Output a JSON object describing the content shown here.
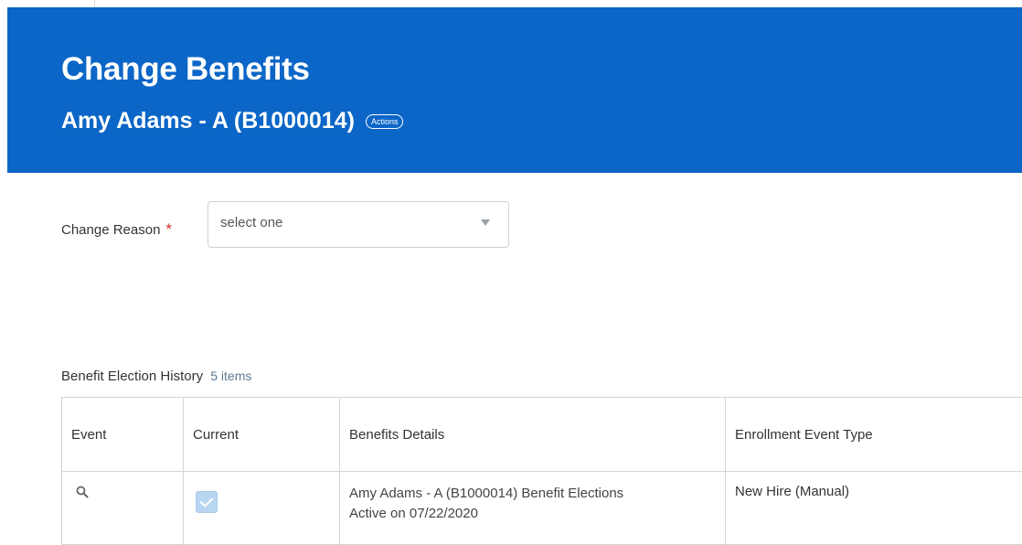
{
  "header": {
    "title": "Change Benefits",
    "worker": "Amy Adams - A (B1000014)",
    "actions_label": "Actions"
  },
  "form": {
    "change_reason_label": "Change Reason",
    "required_mark": "*",
    "change_reason_placeholder": "select one"
  },
  "history": {
    "title": "Benefit Election History",
    "count": "5 items",
    "columns": [
      "Event",
      "Current",
      "Benefits Details",
      "Enrollment Event Type"
    ],
    "rows": [
      {
        "details_line1": "Amy Adams - A (B1000014) Benefit Elections",
        "details_line2": "Active on 07/22/2020",
        "event_type": "New Hire (Manual)",
        "current": true
      }
    ]
  },
  "colors": {
    "banner": "#0b66c7",
    "required": "#d92a2a",
    "checkbox": "#b8d6f2"
  },
  "icons": [
    "search-icon",
    "chevron-down-icon",
    "checkbox-checked-icon"
  ]
}
